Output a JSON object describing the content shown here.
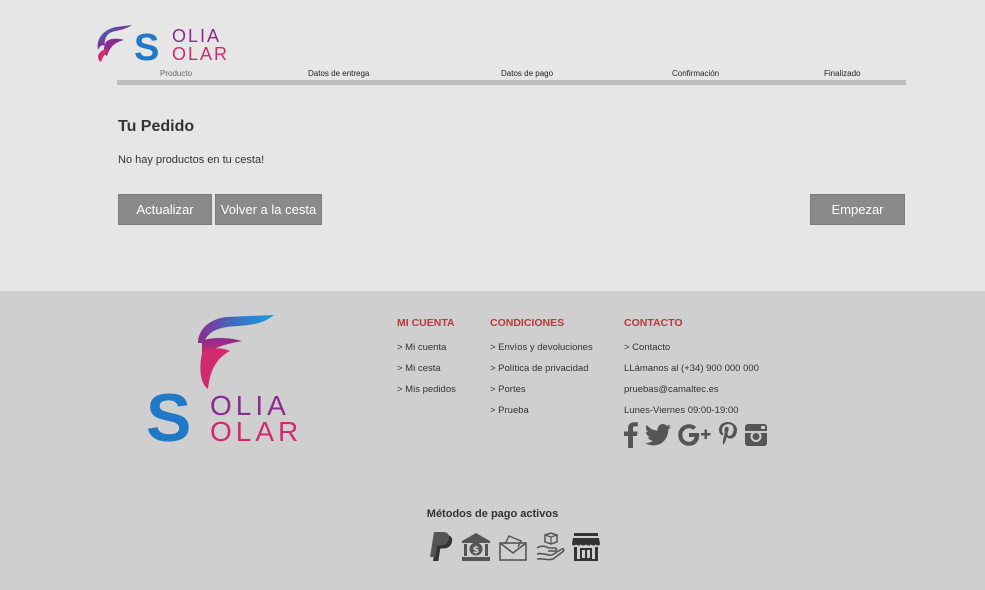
{
  "brand": {
    "line1": "OLIA",
    "line2": "OLAR",
    "letter_s": "S",
    "colors": {
      "blue": "#1f78c8",
      "purple": "#8a2b8f",
      "pink": "#d12a6e"
    }
  },
  "steps": [
    {
      "label": "Producto"
    },
    {
      "label": "Datos de entrega"
    },
    {
      "label": "Datos de pago"
    },
    {
      "label": "Confirmación"
    },
    {
      "label": "Finalizado"
    }
  ],
  "cart": {
    "title": "Tu Pedido",
    "empty_message": "No hay productos en tu cesta!"
  },
  "buttons": {
    "update": "Actualizar",
    "back": "Volver a la cesta",
    "start": "Empezar"
  },
  "footer": {
    "account": {
      "title": "MI CUENTA",
      "items": [
        "> Mi cuenta",
        "> Mi cesta",
        "> Mis pedidos"
      ]
    },
    "conditions": {
      "title": "CONDICIONES",
      "items": [
        "> Envíos y devoluciones",
        "> Política de privacidad",
        "> Portes",
        "> Prueba"
      ]
    },
    "contact": {
      "title": "CONTACTO",
      "items": [
        "> Contacto",
        "LLámanos al (+34) 900 000 000",
        "pruebas@camaltec.es",
        "Lunes-Viernes 09:00-19:00"
      ]
    },
    "social_icons": [
      "facebook-icon",
      "twitter-icon",
      "google-plus-icon",
      "pinterest-icon",
      "instagram-icon"
    ],
    "payments_title": "Métodos de pago activos",
    "payment_icons": [
      "paypal-icon",
      "bank-transfer-icon",
      "cash-envelope-icon",
      "cash-on-delivery-icon",
      "store-pickup-icon"
    ]
  },
  "colors": {
    "accent_red": "#b53a3a",
    "button_gray": "#8a8a8a",
    "icon_gray": "#555555"
  }
}
